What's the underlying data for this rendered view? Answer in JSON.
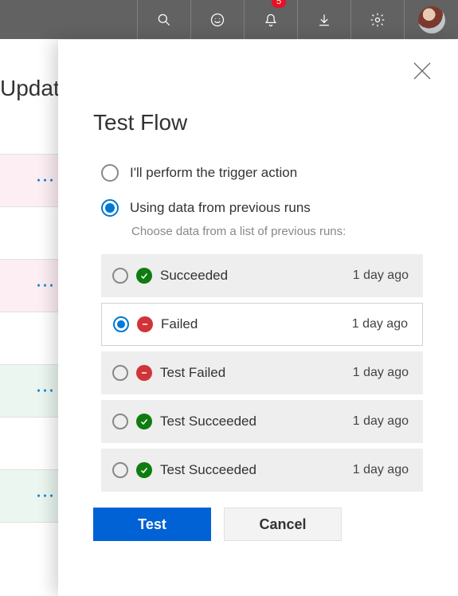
{
  "header": {
    "notification_count": "5"
  },
  "background": {
    "title_cut": "Updat"
  },
  "panel": {
    "title": "Test Flow",
    "option_manual": "I'll perform the trigger action",
    "option_previous": "Using data from previous runs",
    "option_previous_sub": "Choose data from a list of previous runs:",
    "selected_option": "previous"
  },
  "runs": [
    {
      "status": "Succeeded",
      "result": "succ",
      "time": "1 day ago",
      "selected": false
    },
    {
      "status": "Failed",
      "result": "fail",
      "time": "1 day ago",
      "selected": true
    },
    {
      "status": "Test Failed",
      "result": "fail",
      "time": "1 day ago",
      "selected": false
    },
    {
      "status": "Test Succeeded",
      "result": "succ",
      "time": "1 day ago",
      "selected": false
    },
    {
      "status": "Test Succeeded",
      "result": "succ",
      "time": "1 day ago",
      "selected": false
    }
  ],
  "buttons": {
    "primary": "Test",
    "secondary": "Cancel"
  }
}
